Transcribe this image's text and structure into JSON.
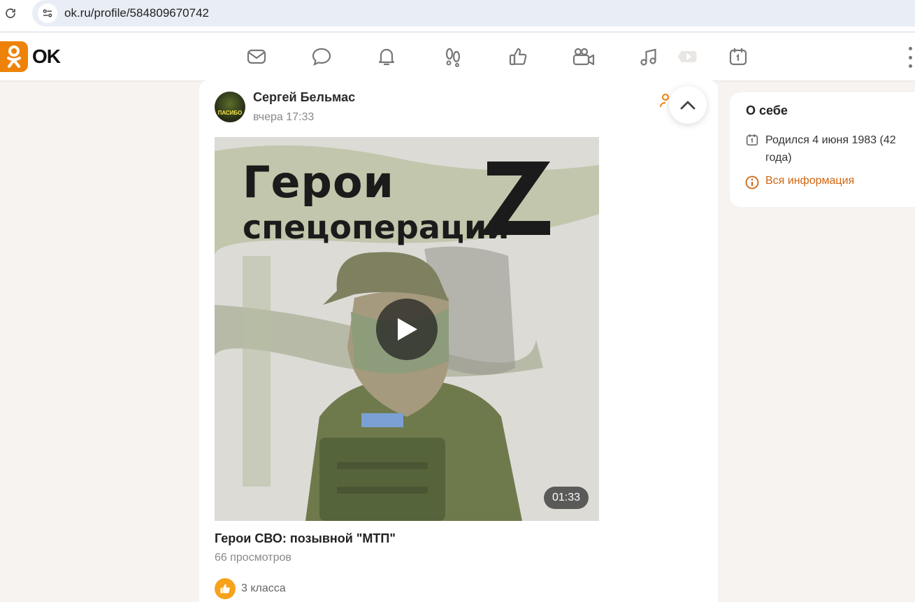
{
  "browser": {
    "url": "ok.ru/profile/584809670742"
  },
  "header": {
    "logo_text": "OK",
    "nav_icons": [
      "mail-icon",
      "chat-icon",
      "bell-icon",
      "footprints-icon",
      "thumbs-up-icon",
      "video-camera-icon",
      "music-icon",
      "video-play-icon",
      "calendar-icon"
    ]
  },
  "post": {
    "author": "Сергей Бельмас",
    "time": "вчера 17:33",
    "avatar_label": "ПАСИБО",
    "video": {
      "poster_line1": "Герои",
      "poster_line2": "спецоперации",
      "duration": "01:33"
    },
    "caption": "Герои СВО: позывной \"МТП\"",
    "views": "66 просмотров",
    "likes": "3 класса"
  },
  "about": {
    "title": "О себе",
    "birth": "Родился 4 июня 1983 (42 года)",
    "all_info": "Вся информация"
  },
  "colors": {
    "accent": "#ee8208",
    "link": "#d1650f",
    "background": "#f6f3f0",
    "like": "#f7a21b"
  }
}
